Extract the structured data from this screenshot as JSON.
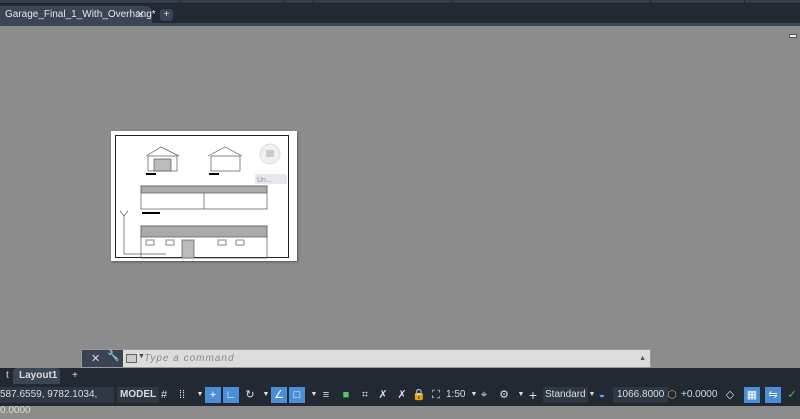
{
  "document_tab": {
    "title": "Garage_Final_1_With_Overhang*",
    "close": "✕",
    "add": "+"
  },
  "viewcube": {
    "label": "Un..."
  },
  "command_line": {
    "placeholder": "Type a command",
    "close": "✕",
    "customize": "🔧"
  },
  "layout_tabs": {
    "partial": "t",
    "active": "Layout1",
    "add": "+"
  },
  "status_bar": {
    "coordinates": "587.6559, 9782.1034, 0.0000",
    "space": "MODEL",
    "scale": "1:50",
    "annotation_style": "Standard",
    "elevation": "1066.8000",
    "offset": "+0.0000"
  }
}
